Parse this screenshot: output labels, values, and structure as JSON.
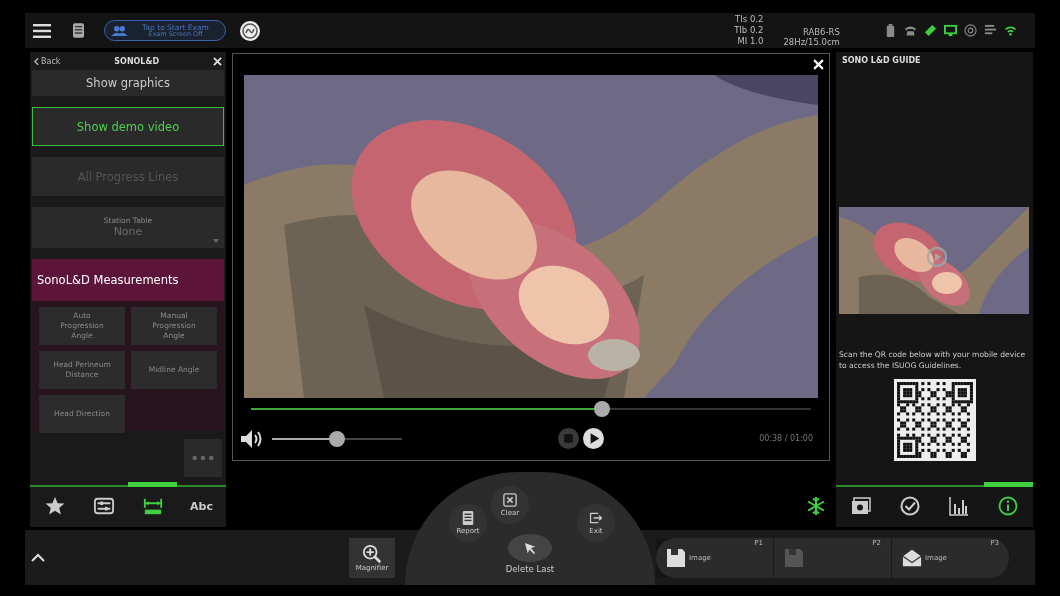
{
  "top_bar": {
    "exam_button": {
      "label": "Tap to Start Exam",
      "sublabel": "Exam Screen Off"
    },
    "readouts": [
      "TIs 0.2",
      "TIb 0.2",
      "MI 1.0"
    ],
    "probe": "RAB6-RS",
    "frame_rate": "28Hz/15.0cm",
    "status_icons": [
      {
        "on": false
      },
      {
        "on": false
      },
      {
        "on": true
      },
      {
        "on": true
      },
      {
        "on": false
      },
      {
        "on": false
      },
      {
        "on": true
      }
    ]
  },
  "left_panel": {
    "back": "Back",
    "title": "SONOL&D",
    "items": [
      {
        "kind": "button",
        "label": "Show graphics",
        "selected": false,
        "disabled": false
      },
      {
        "kind": "button",
        "label": "Show demo video",
        "selected": true,
        "disabled": false
      },
      {
        "kind": "button",
        "label": "All Progress Lines",
        "selected": false,
        "disabled": true
      },
      {
        "kind": "dropdown",
        "label": "Station Table",
        "value": "None",
        "selected": false,
        "disabled": true
      }
    ],
    "section": "SonoL&D Measurements",
    "measurements": [
      {
        "label": "Auto Progression Angle",
        "disabled": true
      },
      {
        "label": "Manual Progression Angle",
        "disabled": true
      },
      {
        "label": "Head Perineum Distance",
        "disabled": true
      },
      {
        "label": "Midline Angle",
        "disabled": true
      },
      {
        "label": "Head Direction",
        "disabled": true
      }
    ],
    "tabs": [
      {
        "kind": "icon",
        "selected": false
      },
      {
        "kind": "icon",
        "selected": false
      },
      {
        "kind": "icon",
        "selected": true
      },
      {
        "kind": "text",
        "label": "Abc",
        "selected": false
      }
    ]
  },
  "video": {
    "progress": {
      "level": 0.63
    },
    "volume": {
      "level": 0.5
    },
    "time": "00:38 / 01:00"
  },
  "right_panel": {
    "title": "SONO L&D GUIDE",
    "instructions": "Scan the QR code below with your mobile device to access the ISUOG Guidelines.",
    "tabs": [
      {
        "selected": false
      },
      {
        "selected": false
      },
      {
        "selected": false
      },
      {
        "selected": true
      }
    ]
  },
  "bottom_bar": {
    "magnifier": "Magnifier",
    "arc_menu": {
      "report": "Report",
      "clear": "Clear",
      "exit": "Exit",
      "center": "Delete Last"
    },
    "print_keys": [
      {
        "key": "P1",
        "label": "Image",
        "disabled": false
      },
      {
        "key": "P2",
        "disabled": true
      },
      {
        "key": "P3",
        "label": "Image",
        "disabled": false
      }
    ]
  }
}
